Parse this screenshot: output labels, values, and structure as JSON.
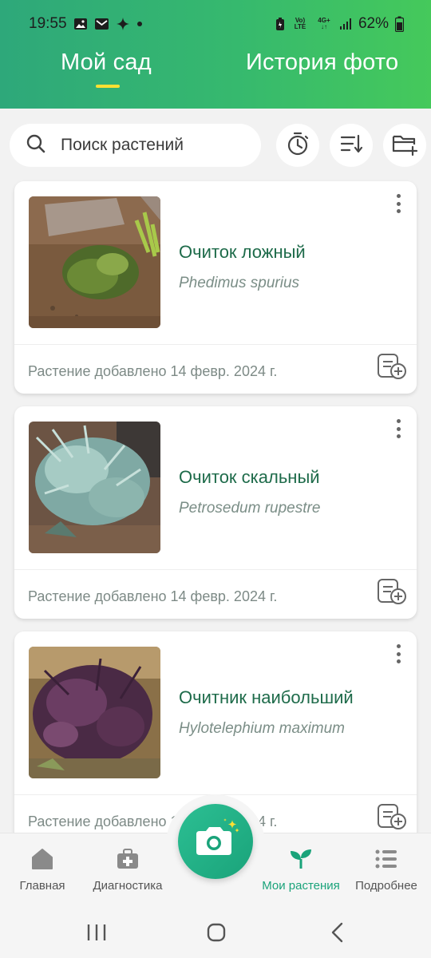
{
  "status_bar": {
    "time": "19:55",
    "battery": "62%",
    "network_top": "4G+",
    "volte": "Vo) LTE"
  },
  "tabs": [
    {
      "label": "Мой сад",
      "active": true
    },
    {
      "label": "История фото",
      "active": false
    }
  ],
  "search": {
    "placeholder": "Поиск растений"
  },
  "toolbar_icons": [
    "alarm-clock-icon",
    "sort-icon",
    "add-folder-icon"
  ],
  "plants": [
    {
      "name": "Очиток ложный",
      "latin": "Phedimus spurius",
      "added": "Растение добавлено 14 февр. 2024 г."
    },
    {
      "name": "Очиток скальный",
      "latin": "Petrosedum rupestre",
      "added": "Растение добавлено 14 февр. 2024 г."
    },
    {
      "name": "Очитник наибольший",
      "latin": "Hylotelephium maximum",
      "added": "Растение добавлено 14 февр. 2024 г."
    }
  ],
  "bottom_nav": [
    {
      "label": "Главная",
      "icon": "home-icon",
      "active": false
    },
    {
      "label": "Диагностика",
      "icon": "medkit-icon",
      "active": false
    },
    {
      "label": "Мои растения",
      "icon": "sprout-icon",
      "active": true
    },
    {
      "label": "Подробнее",
      "icon": "list-icon",
      "active": false
    }
  ],
  "colors": {
    "header_start": "#2ea87a",
    "header_end": "#45c95b",
    "accent": "#1aa37a",
    "tab_indicator": "#ffe033",
    "plant_name": "#1e6b4a"
  }
}
